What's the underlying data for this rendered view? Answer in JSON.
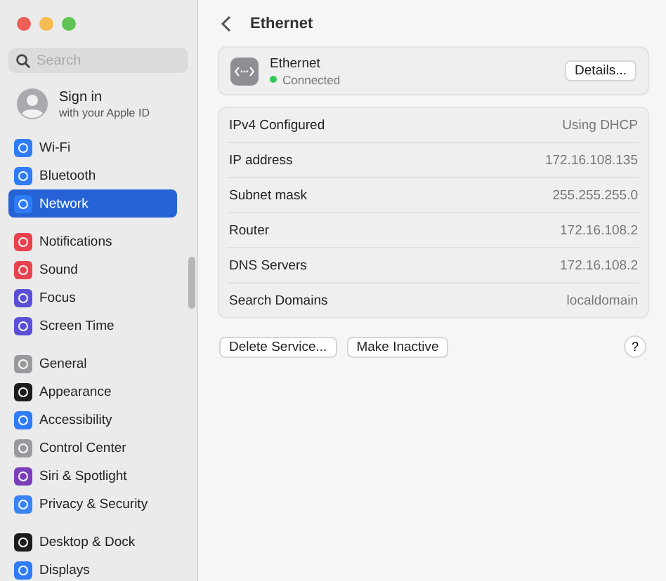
{
  "search": {
    "placeholder": "Search"
  },
  "account": {
    "title": "Sign in",
    "subtitle": "with your Apple ID"
  },
  "sidebar": {
    "groups": [
      [
        {
          "label": "Wi-Fi",
          "color": "#2f7cf6",
          "selected": false
        },
        {
          "label": "Bluetooth",
          "color": "#2f7cf6",
          "selected": false
        },
        {
          "label": "Network",
          "color": "#2f7cf6",
          "selected": true
        }
      ],
      [
        {
          "label": "Notifications",
          "color": "#e8424f",
          "selected": false
        },
        {
          "label": "Sound",
          "color": "#e8424f",
          "selected": false
        },
        {
          "label": "Focus",
          "color": "#5a4fd6",
          "selected": false
        },
        {
          "label": "Screen Time",
          "color": "#5a4fd6",
          "selected": false
        }
      ],
      [
        {
          "label": "General",
          "color": "#9a9a9e",
          "selected": false
        },
        {
          "label": "Appearance",
          "color": "#1c1c1e",
          "selected": false
        },
        {
          "label": "Accessibility",
          "color": "#2f7cf6",
          "selected": false
        },
        {
          "label": "Control Center",
          "color": "#9a9a9e",
          "selected": false
        },
        {
          "label": "Siri & Spotlight",
          "color": "#7a3fb8",
          "selected": false
        },
        {
          "label": "Privacy & Security",
          "color": "#3b82f6",
          "selected": false
        }
      ],
      [
        {
          "label": "Desktop & Dock",
          "color": "#1c1c1e",
          "selected": false
        },
        {
          "label": "Displays",
          "color": "#2f7cf6",
          "selected": false
        }
      ]
    ]
  },
  "page": {
    "title": "Ethernet"
  },
  "service": {
    "name": "Ethernet",
    "status": "Connected",
    "color": "#34c759",
    "button": "Details..."
  },
  "details": [
    {
      "label": "IPv4 Configured",
      "value": "Using DHCP"
    },
    {
      "label": "IP address",
      "value": "172.16.108.135"
    },
    {
      "label": "Subnet mask",
      "value": "255.255.255.0"
    },
    {
      "label": "Router",
      "value": "172.16.108.2"
    },
    {
      "label": "DNS Servers",
      "value": "172.16.108.2"
    },
    {
      "label": "Search Domains",
      "value": "localdomain"
    }
  ],
  "buttons": [
    "Delete Service...",
    "Make Inactive"
  ],
  "help": "?"
}
